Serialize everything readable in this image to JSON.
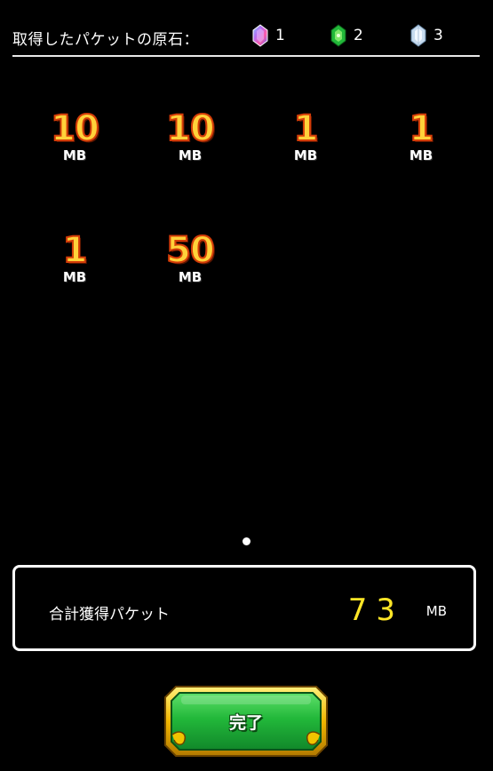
{
  "header": {
    "title": "取得したパケットの原石：",
    "gems": [
      {
        "icon": "rainbow-gem-icon",
        "count": "1",
        "color": "#c070e0"
      },
      {
        "icon": "green-gem-icon",
        "count": "2",
        "color": "#29c43a"
      },
      {
        "icon": "white-gem-icon",
        "count": "3",
        "color": "#d8e6f5"
      }
    ]
  },
  "packets": [
    {
      "value": "10",
      "unit": "MB"
    },
    {
      "value": "10",
      "unit": "MB"
    },
    {
      "value": "1",
      "unit": "MB"
    },
    {
      "value": "1",
      "unit": "MB"
    },
    {
      "value": "1",
      "unit": "MB"
    },
    {
      "value": "50",
      "unit": "MB"
    }
  ],
  "pagination": {
    "current_page": 1,
    "total_pages": 1
  },
  "total": {
    "label": "合計獲得パケット",
    "value": "73",
    "unit": "MB"
  },
  "done_button": {
    "label": "完了"
  },
  "colors": {
    "background": "#000000",
    "packet_value": "#ffd23a",
    "total_value": "#ffe627",
    "button_green": "#22b83a",
    "button_border": "#e8b000"
  }
}
